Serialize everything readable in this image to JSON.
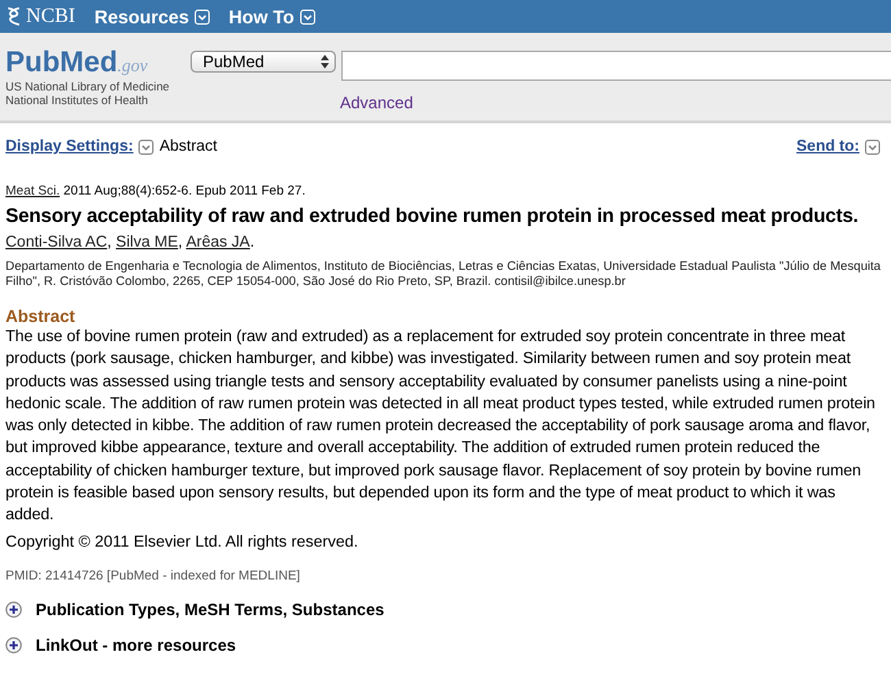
{
  "topbar": {
    "brand": "NCBI",
    "menus": [
      {
        "label": "Resources"
      },
      {
        "label": "How To"
      }
    ]
  },
  "header": {
    "logo": {
      "main": "PubMed",
      "suffix": ".gov"
    },
    "org_lines": [
      "US National Library of Medicine",
      "National Institutes of Health"
    ],
    "database": "PubMed",
    "advanced": "Advanced"
  },
  "toolbar": {
    "display_settings": "Display Settings:",
    "format": "Abstract",
    "send_to": "Send to:"
  },
  "citation": {
    "journal": "Meat Sci.",
    "details": "2011 Aug;88(4):652-6. Epub 2011 Feb 27."
  },
  "title": "Sensory acceptability of raw and extruded bovine rumen protein in processed meat products.",
  "authors": [
    {
      "name": "Conti-Silva AC",
      "punct": ","
    },
    {
      "name": "Silva ME",
      "punct": ","
    },
    {
      "name": "Arêas JA",
      "punct": "."
    }
  ],
  "affiliation": "Departamento de Engenharia e Tecnologia de Alimentos, Instituto de Biociências, Letras e Ciências Exatas, Universidade Estadual Paulista \"Júlio de Mesquita Filho\", R. Cristóvão Colombo, 2265, CEP 15054-000, São José do Rio Preto, SP, Brazil. contisil@ibilce.unesp.br",
  "abstract": {
    "heading": "Abstract",
    "text": "The use of bovine rumen protein (raw and extruded) as a replacement for extruded soy protein concentrate in three meat products (pork sausage, chicken hamburger, and kibbe) was investigated. Similarity between rumen and soy protein meat products was assessed using triangle tests and sensory acceptability evaluated by consumer panelists using a nine-point hedonic scale. The addition of raw rumen protein was detected in all meat product types tested, while extruded rumen protein was only detected in kibbe. The addition of raw rumen protein decreased the acceptability of pork sausage aroma and flavor, but improved kibbe appearance, texture and overall acceptability. The addition of extruded rumen protein reduced the acceptability of chicken hamburger texture, but improved pork sausage flavor. Replacement of soy protein by bovine rumen protein is feasible based upon sensory results, but depended upon its form and the type of meat product to which it was added.",
    "copyright": "Copyright © 2011 Elsevier Ltd. All rights reserved."
  },
  "pmid": "PMID: 21414726 [PubMed - indexed for MEDLINE]",
  "sections": [
    {
      "label": "Publication Types, MeSH Terms, Substances",
      "expanded": false
    },
    {
      "label": "LinkOut - more resources",
      "expanded": false
    }
  ]
}
